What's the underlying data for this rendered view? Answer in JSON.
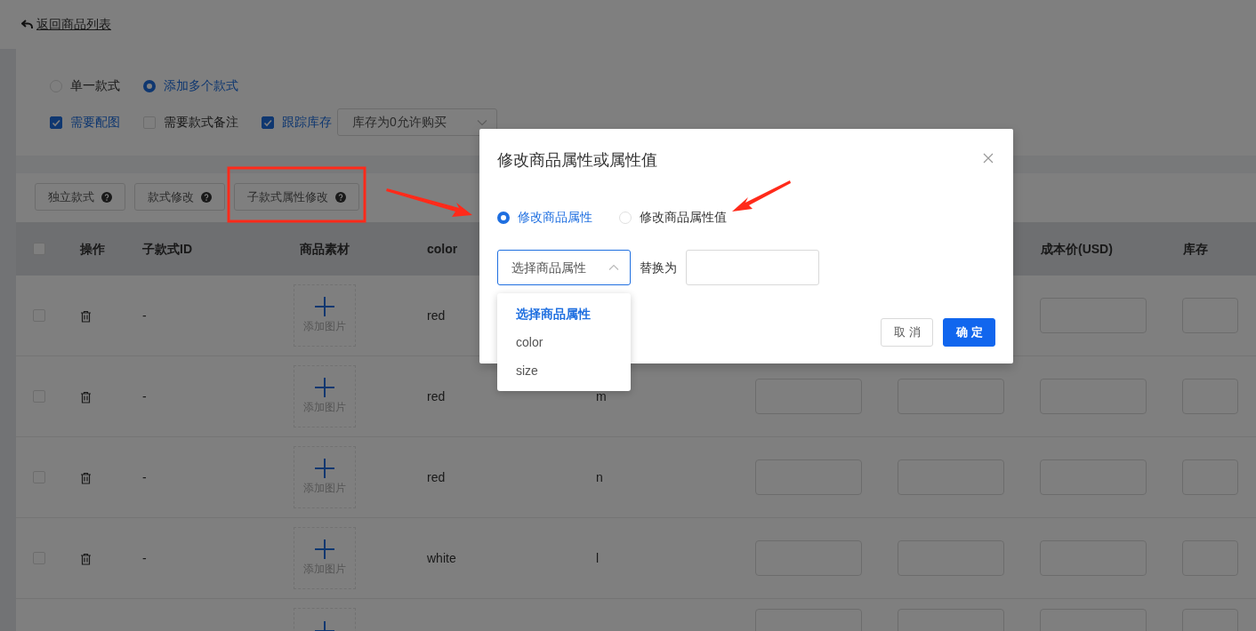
{
  "header": {
    "back_label": "返回商品列表"
  },
  "style_mode": [
    {
      "label": "单一款式",
      "selected": false
    },
    {
      "label": "添加多个款式",
      "selected": true
    }
  ],
  "options": [
    {
      "label": "需要配图",
      "checked": true
    },
    {
      "label": "需要款式备注",
      "checked": false
    },
    {
      "label": "跟踪库存",
      "checked": true
    }
  ],
  "stock_select": {
    "value": "库存为0允许购买"
  },
  "toolbar": [
    {
      "label": "独立款式",
      "annotated": false
    },
    {
      "label": "款式修改",
      "annotated": false
    },
    {
      "label": "子款式属性修改",
      "annotated": true
    }
  ],
  "table": {
    "header_checked": false,
    "columns": {
      "action": "操作",
      "sub_id": "子款式ID",
      "material": "商品素材",
      "attr_1": "color",
      "cost": "成本价(USD)",
      "stock": "库存"
    },
    "rows": [
      {
        "kind": "covered",
        "checked": false,
        "sub_id": "-",
        "upload_label": "添加图片",
        "attr_1": "red"
      },
      {
        "kind": "full",
        "checked": false,
        "sub_id": "-",
        "upload_label": "添加图片",
        "attr_1": "red",
        "attr_2": "m"
      },
      {
        "kind": "full",
        "checked": false,
        "sub_id": "-",
        "upload_label": "添加图片",
        "attr_1": "red",
        "attr_2": "n"
      },
      {
        "kind": "full",
        "checked": false,
        "sub_id": "-",
        "upload_label": "添加图片",
        "attr_1": "white",
        "attr_2": "l"
      },
      {
        "kind": "partial"
      }
    ]
  },
  "dialog": {
    "title": "修改商品属性或属性值",
    "modes": [
      {
        "label": "修改商品属性",
        "selected": true
      },
      {
        "label": "修改商品属性值",
        "selected": false
      }
    ],
    "attribute_select": {
      "value": "选择商品属性",
      "expanded": true,
      "options": [
        {
          "label": "选择商品属性",
          "selected": true
        },
        {
          "label": "color",
          "selected": false
        },
        {
          "label": "size",
          "selected": false
        }
      ]
    },
    "replace_label": "替换为",
    "buttons": [
      {
        "label": "取消",
        "kind": "secondary"
      },
      {
        "label": "确定",
        "kind": "primary"
      }
    ]
  }
}
